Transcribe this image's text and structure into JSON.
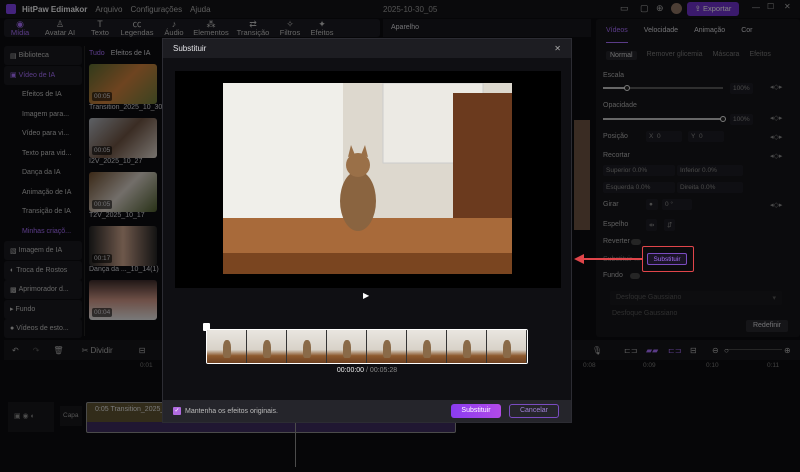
{
  "app": {
    "title": "HitPaw Edimakor",
    "menus": [
      "Arquivo",
      "Configurações",
      "Ajuda"
    ],
    "project": "2025-10-30_05",
    "export_label": "Exportar"
  },
  "toolbar": [
    {
      "label": "Mídia",
      "icon": "media-icon"
    },
    {
      "label": "Avatar AI",
      "icon": "avatar-icon"
    },
    {
      "label": "Texto",
      "icon": "text-icon"
    },
    {
      "label": "Legendas",
      "icon": "captions-icon"
    },
    {
      "label": "Áudio",
      "icon": "audio-icon"
    },
    {
      "label": "Elementos",
      "icon": "elements-icon"
    },
    {
      "label": "Transição",
      "icon": "transition-icon"
    },
    {
      "label": "Filtros",
      "icon": "filters-icon"
    },
    {
      "label": "Efeitos",
      "icon": "effects-icon"
    }
  ],
  "sidebar": {
    "items": [
      "Biblioteca",
      "Vídeo de IA",
      "Efeitos de IA",
      "Imagem para...",
      "Vídeo para vi...",
      "Texto para vid...",
      "Dança da IA",
      "Animação de IA",
      "Transição de IA",
      "Minhas criaçõ...",
      "Imagem de IA",
      "Troca de Rostos",
      "Aprimorador d...",
      "Fundo",
      "Vídeos de esto..."
    ]
  },
  "media": {
    "tabs": [
      "Tudo",
      "Efeitos de IA"
    ],
    "items": [
      {
        "duration": "00:05",
        "name": "Transition_2025_10_30"
      },
      {
        "duration": "00:05",
        "name": "I2V_2025_10_27"
      },
      {
        "duration": "00:05",
        "name": "T2V_2025_10_17"
      },
      {
        "duration": "00:17",
        "name": "Dança da ..._10_14(1)"
      },
      {
        "duration": "00:04",
        "name": ""
      }
    ]
  },
  "preview": {
    "header": "Aparelho"
  },
  "properties": {
    "tabs": [
      "Vídeos",
      "Velocidade",
      "Animação",
      "Cor"
    ],
    "subtabs": [
      "Normal",
      "Remover glicemia",
      "Máscara",
      "Efeitos"
    ],
    "escala_label": "Escala",
    "escala_value": "100%",
    "escala_level": 0.2,
    "opacidade_label": "Opacidade",
    "opacidade_value": "100%",
    "opacidade_level": 1.0,
    "posicao_label": "Posição",
    "x_label": "X",
    "x_value": "0",
    "y_label": "Y",
    "y_value": "0",
    "recortar_label": "Recortar",
    "superior": "Superior 0.0%",
    "inferior": "Inferior   0.0%",
    "esquerda": "Esquerda 0.0%",
    "direita": "Direita    0.0%",
    "girar_label": "Girar",
    "girar_value": "0 °",
    "espelho_label": "Espelho",
    "reverter_label": "Reverter",
    "substituir_label": "Substituir ...",
    "substituir_button": "Substituir",
    "fundo_label": "Fundo",
    "fundo_select": "Desfoque Gaussiano",
    "fundo_sub": "Desfoque Gaussiano",
    "redefinir": "Redefinir"
  },
  "timeline": {
    "dividir": "Dividir",
    "ticks": [
      "0:01",
      "0:08",
      "0:09",
      "0:10",
      "0:11"
    ],
    "capa": "Capa",
    "clip": "0:05 Transition_2025_10_30"
  },
  "dialog": {
    "title": "Substituir",
    "time_current": "00:00:00",
    "time_total": "/ 00:05:28",
    "keep_effects": "Mantenha os efeitos originais.",
    "keep_effects_checked": true,
    "replace_button": "Substituir",
    "cancel_button": "Cancelar"
  },
  "colors": {
    "accent": "#a36bf5",
    "highlight": "#e0454a"
  }
}
